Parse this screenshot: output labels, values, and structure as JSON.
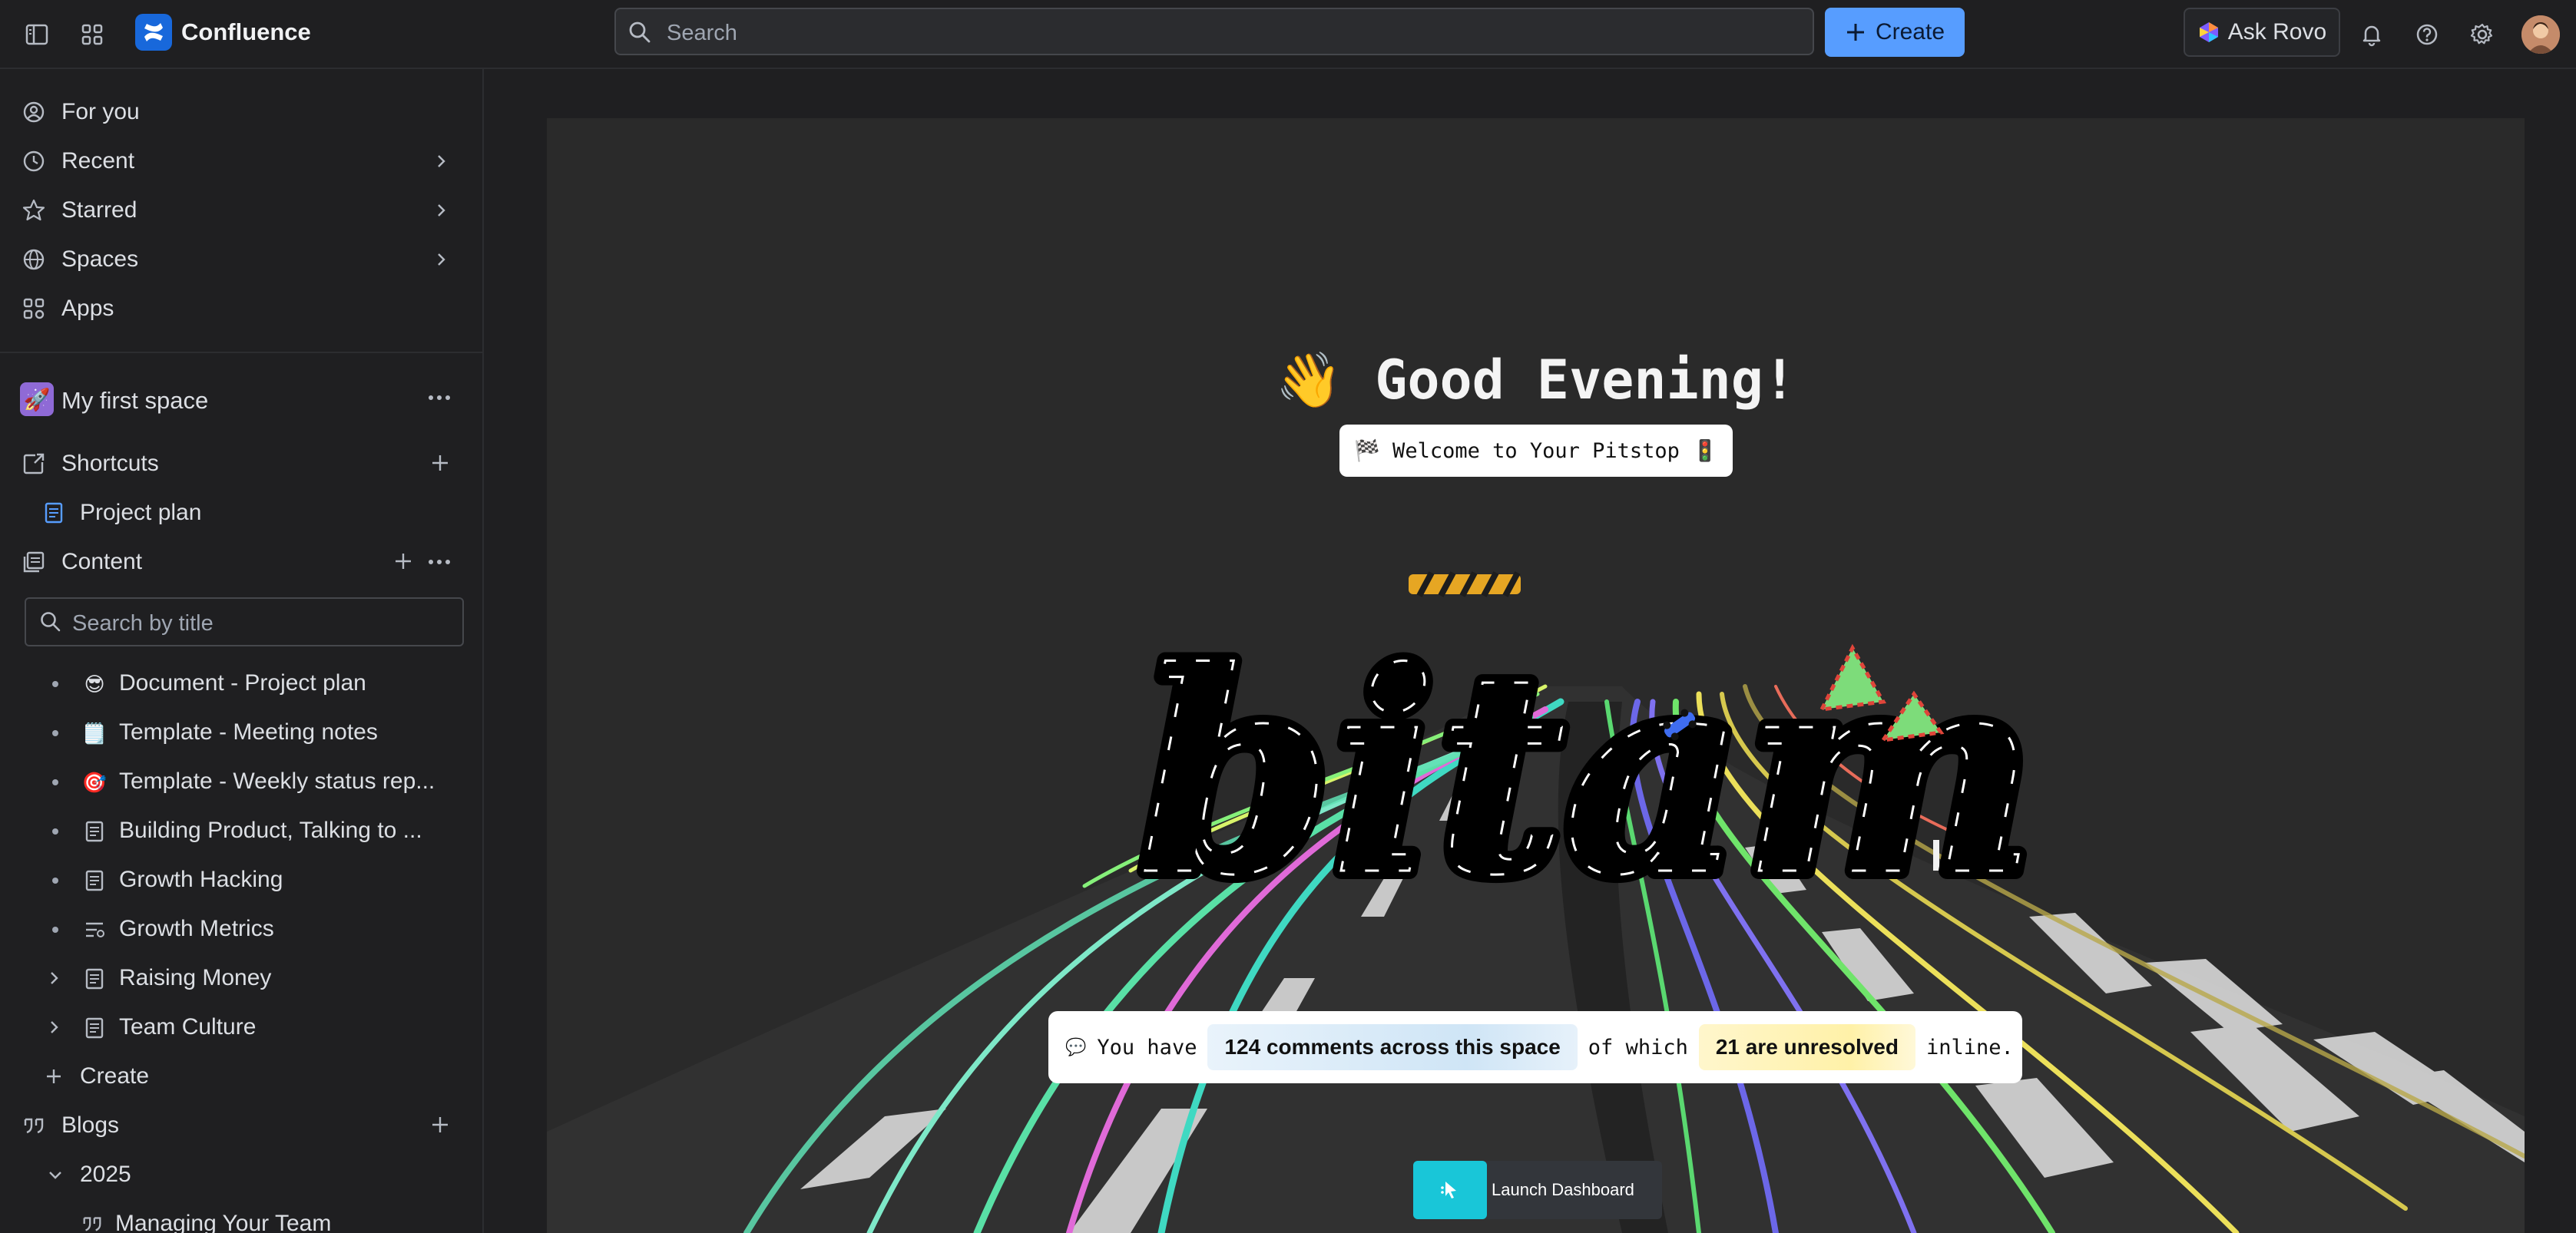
{
  "topbar": {
    "app_name": "Confluence",
    "search_placeholder": "Search",
    "create_label": "Create",
    "ask_rovo_label": "Ask Rovo",
    "icons": [
      "sidebar-toggle-icon",
      "app-switcher-icon",
      "confluence-logo-icon",
      "search-icon",
      "plus-icon",
      "rovo-icon",
      "bell-icon",
      "help-icon",
      "gear-icon",
      "avatar"
    ]
  },
  "sidebar": {
    "nav": [
      {
        "label": "For you",
        "icon": "user-circle-icon"
      },
      {
        "label": "Recent",
        "icon": "clock-icon"
      },
      {
        "label": "Starred",
        "icon": "star-icon"
      },
      {
        "label": "Spaces",
        "icon": "globe-icon"
      },
      {
        "label": "Apps",
        "icon": "apps-icon"
      }
    ],
    "space_name": "My first space",
    "shortcuts_label": "Shortcuts",
    "shortcut_item": "Project plan",
    "content_label": "Content",
    "search_placeholder": "Search by title",
    "tree": [
      {
        "label": "Document - Project plan",
        "icon": "😎"
      },
      {
        "label": "Template - Meeting notes",
        "icon": "🗒️"
      },
      {
        "label": "Template - Weekly status rep...",
        "icon": "🎯"
      },
      {
        "label": "Building Product, Talking to ...",
        "icon": "page-icon"
      },
      {
        "label": "Growth Hacking",
        "icon": "page-icon"
      },
      {
        "label": "Growth Metrics",
        "icon": "database-icon"
      },
      {
        "label": "Raising Money",
        "icon": "page-icon"
      },
      {
        "label": "Team Culture",
        "icon": "page-icon"
      }
    ],
    "create_label": "Create",
    "blogs_label": "Blogs",
    "year_label": "2025",
    "blog_item": "Managing Your Team"
  },
  "main": {
    "greeting_emoji": "👋",
    "greeting": "Good Evening!",
    "welcome": "🏁 Welcome to Your Pitstop 🚦",
    "logo_word": "bitam",
    "stats": {
      "emoji": "💬",
      "prefix": "You have",
      "comments": "124 comments across this space",
      "middle": "of which",
      "unresolved": "21 are unresolved",
      "suffix": "inline."
    },
    "launch_label": "Launch Dashboard"
  },
  "colors": {
    "accent": "#579dff",
    "brand": "#1868db",
    "launch": "#19c6d8"
  }
}
